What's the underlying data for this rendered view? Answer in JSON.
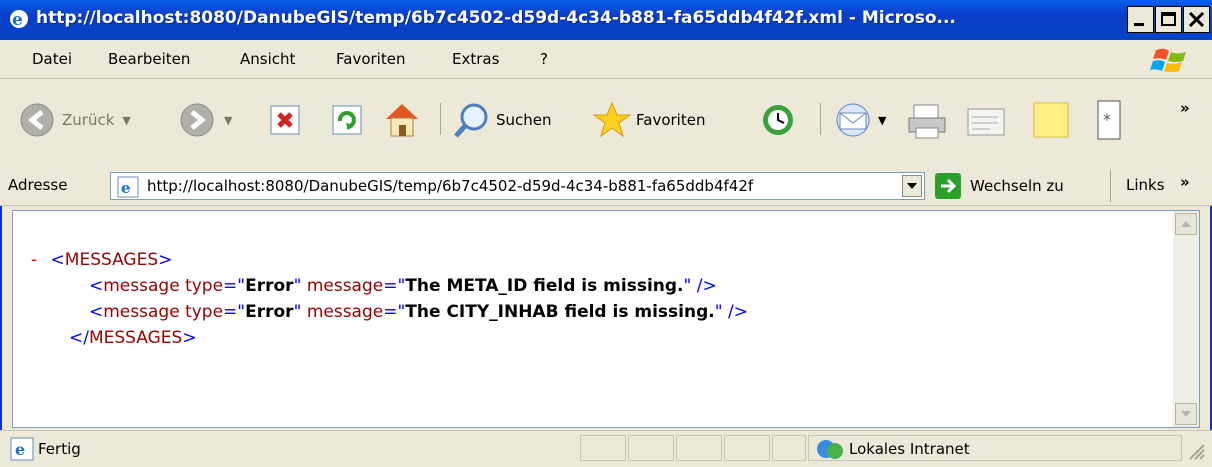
{
  "window": {
    "title": "http://localhost:8080/DanubeGIS/temp/6b7c4502-d59d-4c34-b881-fa65ddb4f42f.xml - Microso..."
  },
  "menu": [
    "Datei",
    "Bearbeiten",
    "Ansicht",
    "Favoriten",
    "Extras",
    "?"
  ],
  "toolbar": {
    "back_label": "Zurück",
    "search_label": "Suchen",
    "favorites_label": "Favoriten",
    "chevron": "»"
  },
  "address": {
    "label": "Adresse",
    "url": "http://localhost:8080/DanubeGIS/temp/6b7c4502-d59d-4c34-b881-fa65ddb4f42f",
    "go_label": "Wechseln zu",
    "links_label": "Links",
    "chevron": "»"
  },
  "xml": {
    "collapse": "-",
    "root_open": "MESSAGES",
    "root_close": "MESSAGES",
    "messages": [
      {
        "tag": "message",
        "type_attr": "type",
        "type_val": "Error",
        "msg_attr": "message",
        "msg_val": "The META_ID field is missing."
      },
      {
        "tag": "message",
        "type_attr": "type",
        "type_val": "Error",
        "msg_attr": "message",
        "msg_val": "The CITY_INHAB field is missing."
      }
    ]
  },
  "status": {
    "text": "Fertig",
    "zone": "Lokales Intranet"
  }
}
